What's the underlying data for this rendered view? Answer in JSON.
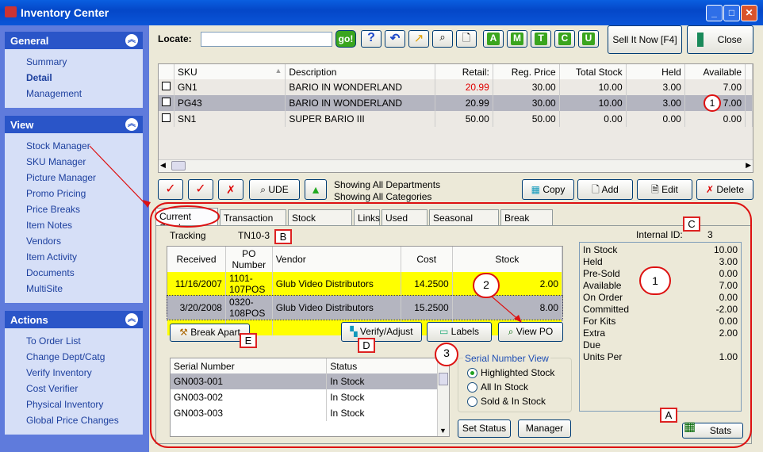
{
  "window": {
    "title": "Inventory Center",
    "controls": [
      "_",
      "□",
      "✕"
    ]
  },
  "sidebar": {
    "groups": [
      {
        "title": "General",
        "items": [
          {
            "label": "Summary"
          },
          {
            "label": "Detail",
            "active": true
          },
          {
            "label": "Management"
          }
        ]
      },
      {
        "title": "View",
        "items": [
          {
            "label": "Stock Manager"
          },
          {
            "label": "SKU Manager"
          },
          {
            "label": "Picture Manager"
          },
          {
            "label": "Promo Pricing"
          },
          {
            "label": "Price Breaks"
          },
          {
            "label": "Item Notes"
          },
          {
            "label": "Vendors"
          },
          {
            "label": "Item Activity"
          },
          {
            "label": "Documents"
          },
          {
            "label": "MultiSite"
          }
        ]
      },
      {
        "title": "Actions",
        "items": [
          {
            "label": "To Order List"
          },
          {
            "label": "Change Dept/Catg"
          },
          {
            "label": "Verify Inventory"
          },
          {
            "label": "Cost Verifier"
          },
          {
            "label": "Physical Inventory"
          },
          {
            "label": "Global Price Changes"
          }
        ]
      }
    ]
  },
  "toolbar": {
    "locate_label": "Locate:",
    "locate_value": "",
    "go_label": "go!",
    "letter_buttons": [
      "A",
      "M",
      "T",
      "C",
      "U"
    ],
    "sell_now": "Sell It Now [F4]",
    "close": "Close"
  },
  "items_grid": {
    "columns": [
      "SKU",
      "Description",
      "Retail:",
      "Reg. Price",
      "Total Stock",
      "Held",
      "Available"
    ],
    "rows": [
      {
        "sku": "GN1",
        "description": "BARIO IN WONDERLAND",
        "retail": "20.99",
        "reg_price": "30.00",
        "total_stock": "10.00",
        "held": "3.00",
        "available": "7.00",
        "retail_color": "#e00000"
      },
      {
        "sku": "PG43",
        "description": "BARIO IN WONDERLAND",
        "retail": "20.99",
        "reg_price": "30.00",
        "total_stock": "10.00",
        "held": "3.00",
        "available": "7.00",
        "selected": true
      },
      {
        "sku": "SN1",
        "description": "SUPER BARIO III",
        "retail": "50.00",
        "reg_price": "50.00",
        "total_stock": "0.00",
        "held": "0.00",
        "available": "0.00"
      }
    ]
  },
  "action_bar": {
    "ude": "UDE",
    "status_line1": "Showing All Departments",
    "status_line2": "Showing All Categories",
    "copy": "Copy",
    "add": "Add",
    "edit": "Edit",
    "delete": "Delete"
  },
  "tabs": [
    "Current Stock",
    "Transaction Log",
    "Stock Location",
    "Links",
    "Used Items",
    "Seasonal Levels",
    "Break Apart"
  ],
  "current_stock": {
    "tracking_label": "Tracking",
    "tracking_value": "TN10-3",
    "internal_id_label": "Internal ID:",
    "internal_id_value": "3",
    "po_columns": [
      "Received",
      "PO Number",
      "Vendor",
      "Cost",
      "Stock"
    ],
    "po_rows": [
      {
        "received": "11/16/2007",
        "po": "1101-107POS",
        "vendor": "Glub Video Distributors",
        "cost": "14.2500",
        "stock": "2.00"
      },
      {
        "received": "3/20/2008",
        "po": "0320-108POS",
        "vendor": "Glub Video Distributors",
        "cost": "15.2500",
        "stock": "8.00",
        "selected": true
      }
    ],
    "buttons": {
      "break_apart": "Break Apart",
      "verify": "Verify/Adjust",
      "labels": "Labels",
      "view_po": "View PO",
      "set_status": "Set Status",
      "manager": "Manager",
      "stats": "Stats"
    },
    "serial_columns": [
      "Serial Number",
      "Status"
    ],
    "serial_rows": [
      {
        "serial": "GN003-001",
        "status": "In Stock",
        "selected": true
      },
      {
        "serial": "GN003-002",
        "status": "In Stock"
      },
      {
        "serial": "GN003-003",
        "status": "In Stock"
      }
    ],
    "serial_view": {
      "title": "Serial Number View",
      "options": [
        {
          "label": "Highlighted Stock",
          "selected": true
        },
        {
          "label": "All In Stock"
        },
        {
          "label": "Sold & In Stock"
        }
      ]
    },
    "stats": [
      {
        "label": "In Stock",
        "value": "10.00"
      },
      {
        "label": "Held",
        "value": "3.00"
      },
      {
        "label": "Pre-Sold",
        "value": "0.00"
      },
      {
        "label": "Available",
        "value": "7.00"
      },
      {
        "label": "On Order",
        "value": "0.00"
      },
      {
        "label": "Committed",
        "value": "-2.00"
      },
      {
        "label": "For Kits",
        "value": "0.00"
      },
      {
        "label": "Extra",
        "value": "2.00"
      },
      {
        "label": "Due",
        "value": ""
      },
      {
        "label": "Units Per",
        "value": "1.00"
      }
    ]
  },
  "annotations": {
    "letters": [
      "A",
      "B",
      "C",
      "D",
      "E"
    ],
    "numbers": [
      "1",
      "1",
      "2",
      "3"
    ],
    "color": "#dd1111"
  }
}
